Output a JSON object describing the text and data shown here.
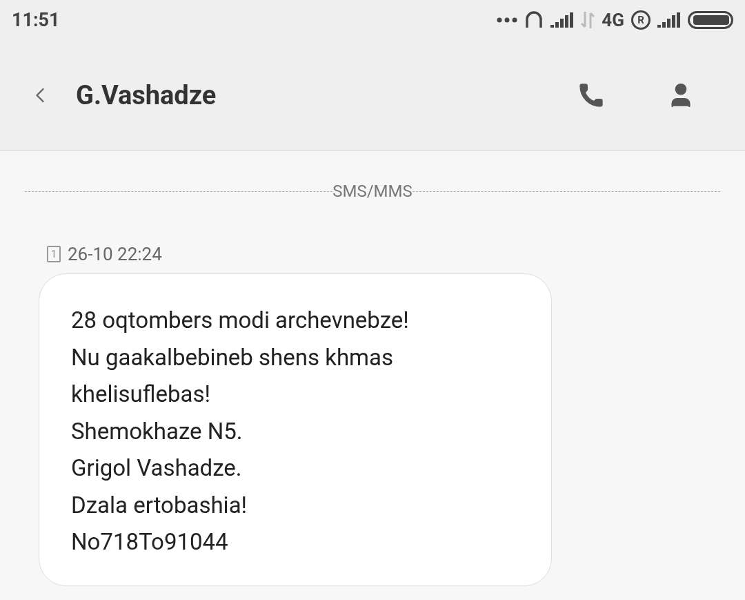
{
  "status_bar": {
    "time": "11:51",
    "network": "4G",
    "roaming": "R"
  },
  "header": {
    "title": "G.Vashadze"
  },
  "divider_label": "SMS/MMS",
  "message": {
    "sim": "1",
    "timestamp": "26-10 22:24",
    "text": "28 oqtombers modi archevnebze!\nNu gaakalbebineb shens khmas khelisuflebas!\nShemokhaze N5.\nGrigol Vashadze.\nDzala ertobashia!\nNo718To91044"
  }
}
